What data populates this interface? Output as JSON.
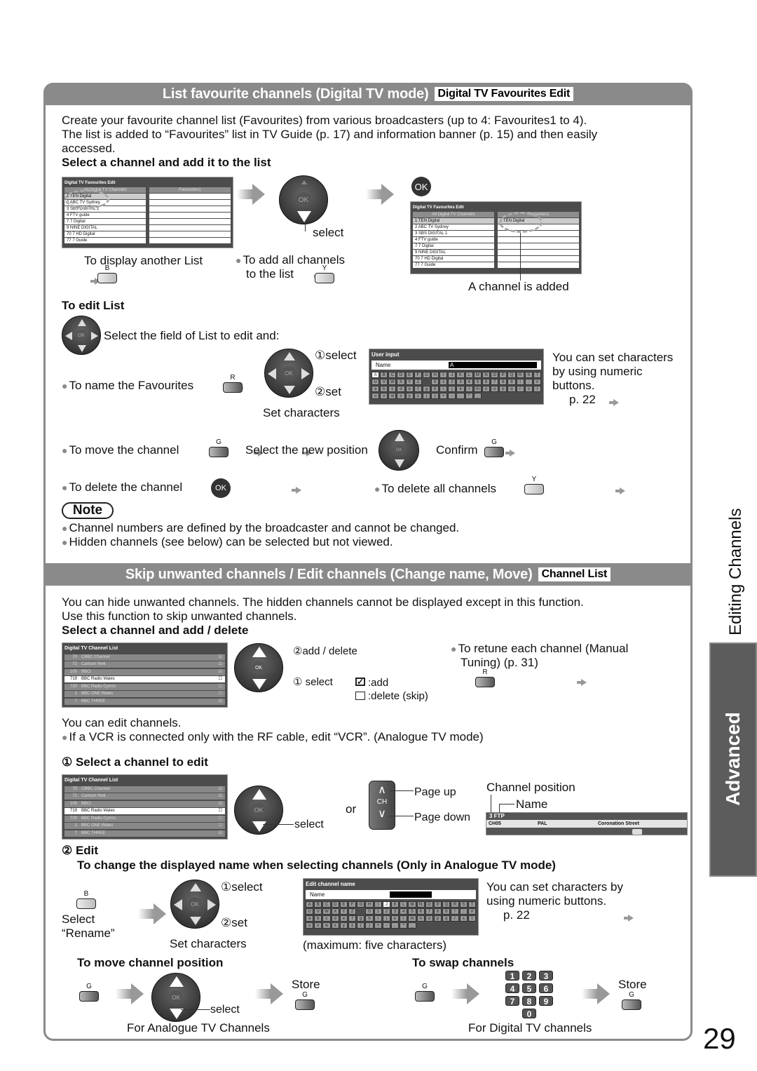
{
  "page_number": "29",
  "side": {
    "section_label": "Editing Channels",
    "tab_label": "Advanced"
  },
  "section1": {
    "title": "List favourite channels (Digital TV mode)",
    "badge": "Digital TV Favourites Edit",
    "intro": [
      "Create your favourite channel list (Favourites) from various broadcasters (up to 4: Favourites1 to 4).",
      "The list is added to “Favourites” list in TV Guide (p. 17) and information banner (p. 15) and then easily",
      "accessed."
    ],
    "step_heading": "Select a channel and add it to the list",
    "screen_left": {
      "title": "Digital TV Favourites Edit",
      "col1_header": "All Digital TV Channels",
      "col2_header": "Favourites1",
      "channels": [
        "1  TEN Digital",
        "2  ABC TV Sydney",
        "3  SBS DIGITAL 1",
        "4  FTV guide",
        "7  7 Digital",
        "9  NINE DIGITAL",
        "70  7 HD Digital",
        "77  7 Guide"
      ],
      "favourites": [
        "",
        "",
        "",
        "",
        "",
        "",
        "",
        ""
      ]
    },
    "screen_right": {
      "title": "Digital TV Favourites Edit",
      "col1_header": "All Digital TV Channels",
      "col2_header": "Favourites1",
      "channels": [
        "1  TEN Digital",
        "2  ABC TV Sydney",
        "3  SBS DIGITAL 1",
        "4  FTV guide",
        "7  7 Digital",
        "9  NINE DIGITAL",
        "70  7 HD Digital",
        "77  7 Guide"
      ],
      "favourites": [
        "1  TEN Digital",
        "",
        "",
        "",
        "",
        "",
        "",
        ""
      ]
    },
    "select_label": "select",
    "ok_label": "OK",
    "display_another": "To display another List",
    "add_all_1": "To add all channels",
    "add_all_2": "to the list",
    "channel_added": "A channel is added",
    "btn_b": "B",
    "btn_y": "Y",
    "btn_r": "R",
    "btn_g": "G",
    "edit_heading": "To edit List",
    "select_field": "Select the field of List to edit and:",
    "name_favourites": "To name the Favourites",
    "step1_select": "①select",
    "step2_set": "②set",
    "set_characters": "Set characters",
    "user_input": {
      "title": "User input",
      "name_label": "Name",
      "value": "A",
      "keys": [
        "A",
        "B",
        "C",
        "D",
        "E",
        "F",
        "G",
        "H",
        "I",
        "J",
        "K",
        "L",
        "M",
        "N",
        "O",
        "P",
        "Q",
        "R",
        "S",
        "T",
        "U",
        "V",
        "W",
        "X",
        "Y",
        "Z",
        "",
        "0",
        "1",
        "2",
        "3",
        "4",
        "5",
        "6",
        "7",
        "8",
        "9",
        "!",
        ":",
        "#",
        "a",
        "b",
        "c",
        "d",
        "e",
        "f",
        "g",
        "h",
        "i",
        "j",
        "k",
        "l",
        "m",
        "n",
        "o",
        "p",
        "q",
        "r",
        "s",
        "t",
        "u",
        "v",
        "w",
        "x",
        "y",
        "z",
        "(",
        ")",
        "+",
        "-",
        ".",
        "*",
        "_"
      ]
    },
    "numeric_note": [
      "You can set characters",
      "by using numeric",
      "buttons."
    ],
    "numeric_ref": "p. 22",
    "move_channel": "To move the channel",
    "select_new_position": "Select the new position",
    "confirm": "Confirm",
    "delete_channel": "To delete the channel",
    "delete_all": "To delete all channels",
    "note_label": "Note",
    "notes": [
      "Channel numbers are defined by the broadcaster and cannot be changed.",
      "Hidden channels (see below) can be selected but not viewed."
    ]
  },
  "section2": {
    "title": "Skip unwanted channels / Edit channels (Change name, Move)",
    "badge": "Channel List",
    "intro": [
      "You can hide unwanted channels. The hidden channels cannot be displayed except in this function.",
      "Use this function to skip unwanted channels."
    ],
    "step_heading": "Select a channel and add / delete",
    "channel_list": {
      "title": "Digital TV Channel List",
      "rows": [
        {
          "num": "70",
          "name": "CBBC Channel",
          "checked": true,
          "selected": false
        },
        {
          "num": "72",
          "name": "Cartoon Nwk",
          "checked": true,
          "selected": false
        },
        {
          "num": "105",
          "name": "BBCi",
          "checked": true,
          "selected": false
        },
        {
          "num": "719",
          "name": "BBC Radio Wales",
          "checked": false,
          "selected": true
        },
        {
          "num": "720",
          "name": "BBC Radio Cymru",
          "checked": false,
          "selected": false
        },
        {
          "num": "1",
          "name": "BBC ONE Wales",
          "checked": false,
          "selected": false
        },
        {
          "num": "7",
          "name": "BBC THREE",
          "checked": true,
          "selected": false
        }
      ]
    },
    "add_delete": "②add / delete",
    "step1_select": "① select",
    "legend_add": ":add",
    "legend_delete": ":delete (skip)",
    "retune": [
      "To retune each channel (Manual",
      "Tuning) (p. 31)"
    ],
    "can_edit": "You can edit channels.",
    "vcr_note": "If a VCR is connected only with the RF cable, edit “VCR”. (Analogue TV mode)",
    "step1_heading": "① Select a channel to edit",
    "or": "or",
    "page_up": "Page up",
    "page_down": "Page down",
    "ch_label": "CH",
    "select_label": "select",
    "channel_position": "Channel position",
    "name_label": "Name",
    "banner": {
      "title": "3 FTP",
      "ch": "CH05",
      "system": "PAL",
      "programme": "Coronation Street"
    },
    "step2_heading": "② Edit",
    "rename_heading": "To change the displayed name when selecting channels (Only in Analogue TV mode)",
    "select_rename_1": "Select",
    "select_rename_2": "“Rename”",
    "step1b": "①select",
    "step2b": "②set",
    "set_characters": "Set characters",
    "edit_name": {
      "title": "Edit channel name",
      "name_label": "Name",
      "value": "",
      "highlight": "J"
    },
    "max_chars": "(maximum: five characters)",
    "numeric_note": [
      "You can set characters by",
      "using numeric buttons."
    ],
    "numeric_ref": "p. 22",
    "move_heading": "To move channel position",
    "swap_heading": "To swap channels",
    "store": "Store",
    "analogue_caption": "For Analogue TV Channels",
    "digital_caption": "For Digital TV channels",
    "numpad": [
      "1",
      "2",
      "3",
      "4",
      "5",
      "6",
      "7",
      "8",
      "9",
      "0"
    ]
  }
}
